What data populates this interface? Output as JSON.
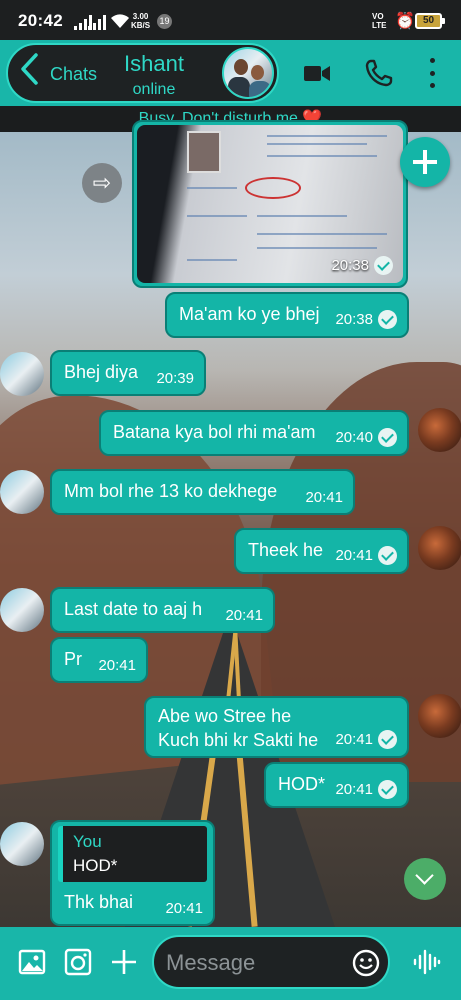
{
  "status_bar": {
    "time": "20:42",
    "speed_value": "3.00",
    "speed_unit": "KB/S",
    "notification_count": "19",
    "volte_line1": "VO",
    "volte_line2": "LTE",
    "battery": "50"
  },
  "header": {
    "back_label": "Chats",
    "contact_name": "Ishant",
    "contact_status": "online",
    "icons": [
      "video-call-icon",
      "voice-call-icon",
      "more-options-icon"
    ]
  },
  "about": {
    "text": "Busy, Don't disturb me ❤️"
  },
  "messages": [
    {
      "type": "image",
      "direction": "out",
      "time": "20:38"
    },
    {
      "direction": "out",
      "text": "Ma'am ko ye bhej",
      "time": "20:38"
    },
    {
      "direction": "in",
      "text": "Bhej diya",
      "time": "20:39"
    },
    {
      "direction": "out",
      "text": "Batana kya bol rhi ma'am",
      "time": "20:40"
    },
    {
      "direction": "in",
      "text": "Mm bol rhe 13 ko dekhege",
      "time": "20:41"
    },
    {
      "direction": "out",
      "text": "Theek he",
      "time": "20:41"
    },
    {
      "direction": "in",
      "text": "Last date to aaj h",
      "time": "20:41"
    },
    {
      "direction": "in",
      "text": "Pr",
      "time": "20:41"
    },
    {
      "direction": "out",
      "text": "Abe wo Stree he",
      "text2": "Kuch bhi kr Sakti he",
      "time": "20:41"
    },
    {
      "direction": "out",
      "text": "HOD*",
      "time": "20:41"
    },
    {
      "direction": "in",
      "reply_author": "You",
      "reply_quote": "HOD*",
      "text": "Thk bhai",
      "time": "20:41"
    }
  ],
  "composer": {
    "placeholder": "Message",
    "icons": [
      "gallery-icon",
      "camera-icon",
      "add-icon",
      "emoji-icon",
      "voice-wave-icon"
    ]
  },
  "colors": {
    "accent": "#14b5a7",
    "accent_bright": "#2fd8c6",
    "dark": "#1e2223",
    "scroll_fab": "#4cad68"
  }
}
